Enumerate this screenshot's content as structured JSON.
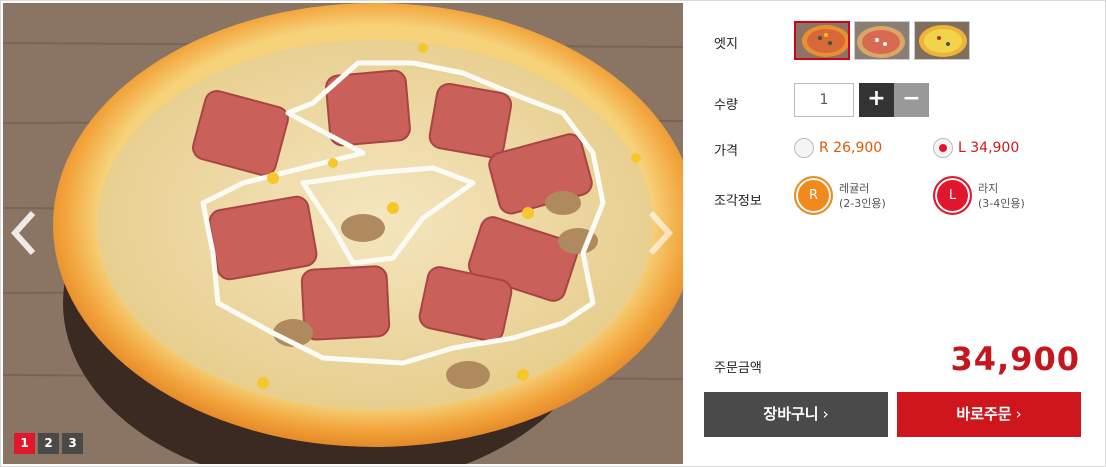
{
  "gallery": {
    "pages": [
      "1",
      "2",
      "3"
    ],
    "active_page": "1"
  },
  "options": {
    "edge_label": "엣지",
    "quantity_label": "수량",
    "quantity_value": "1",
    "plus_label": "+",
    "minus_label": "−",
    "price_label": "가격",
    "price_regular": "R 26,900",
    "price_large": "L 34,900",
    "selected_size": "L",
    "slice_label": "조각정보",
    "size_regular_badge": "R",
    "size_regular_name": "레귤러",
    "size_regular_people": "(2-3인용)",
    "size_large_badge": "L",
    "size_large_name": "라지",
    "size_large_people": "(3-4인용)"
  },
  "order": {
    "total_label": "주문금액",
    "total_value": "34,900",
    "cart_button": "장바구니",
    "order_button": "바로주문",
    "chevron": "›"
  },
  "colors": {
    "accent_red": "#d0161d",
    "price_orange": "#e05a00",
    "regular_badge": "#f08a1d",
    "large_badge": "#e2172d"
  },
  "icons": {
    "prev": "chevron-left-icon",
    "next": "chevron-right-icon"
  }
}
